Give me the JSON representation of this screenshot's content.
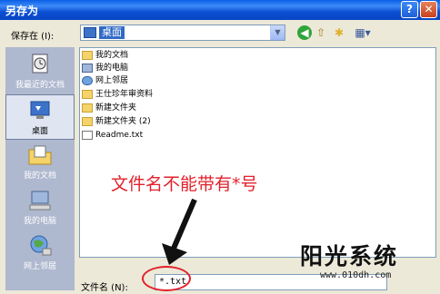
{
  "window": {
    "title": "另存为",
    "help_label": "?",
    "close_label": "✕"
  },
  "toolbar": {
    "save_in_label": "保存在 (I):",
    "location_value": "桌面",
    "dropdown_arrow": "▼",
    "back_icon": "◀",
    "up_icon": "⇧",
    "newfolder_icon": "✱",
    "views_icon": "▦▾"
  },
  "places": [
    {
      "label": "我最近的文档",
      "icon": "recent-documents-icon"
    },
    {
      "label": "桌面",
      "icon": "desktop-icon"
    },
    {
      "label": "我的文档",
      "icon": "my-documents-icon"
    },
    {
      "label": "我的电脑",
      "icon": "my-computer-icon"
    },
    {
      "label": "网上邻居",
      "icon": "network-icon"
    }
  ],
  "files": [
    {
      "name": "我的文档",
      "icon": "folder"
    },
    {
      "name": "我的电脑",
      "icon": "computer"
    },
    {
      "name": "网上邻居",
      "icon": "network"
    },
    {
      "name": "王仕珍年审资料",
      "icon": "folder"
    },
    {
      "name": "新建文件夹",
      "icon": "folder"
    },
    {
      "name": "新建文件夹 (2)",
      "icon": "folder"
    },
    {
      "name": "Readme.txt",
      "icon": "document"
    }
  ],
  "annotation": "文件名不能带有*号",
  "filename": {
    "label": "文件名 (N):",
    "value": "*.txt"
  },
  "watermark": {
    "main": "阳光系统",
    "url": "www.010dh.com"
  },
  "colors": {
    "titlebar": "#0a5fe6",
    "annotation": "#e3212b",
    "places_bar": "#aeb8cf"
  }
}
